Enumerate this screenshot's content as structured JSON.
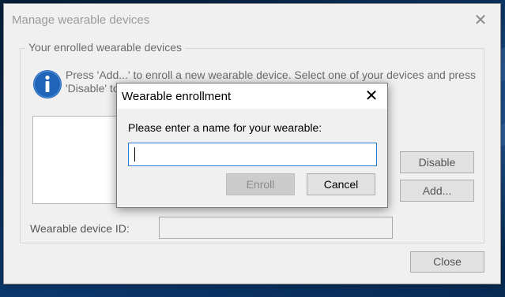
{
  "main_dialog": {
    "title": "Manage wearable devices",
    "group_label": "Your enrolled wearable devices",
    "info_text": "Press 'Add...' to enroll a new wearable device. Select one of your devices and press 'Disable' to",
    "disable_label": "Disable",
    "add_label": "Add...",
    "device_id_label": "Wearable device ID:",
    "device_id_value": "",
    "close_label": "Close"
  },
  "enroll_dialog": {
    "title": "Wearable enrollment",
    "prompt": "Please enter a name for your wearable:",
    "name_value": "",
    "enroll_label": "Enroll",
    "cancel_label": "Cancel"
  },
  "icons": {
    "info": "info-icon",
    "close": "close-icon"
  },
  "colors": {
    "input_focus_border": "#2a7ad5",
    "info_icon_fill": "#1f64b8",
    "desktop_background": "#0c3a72"
  }
}
